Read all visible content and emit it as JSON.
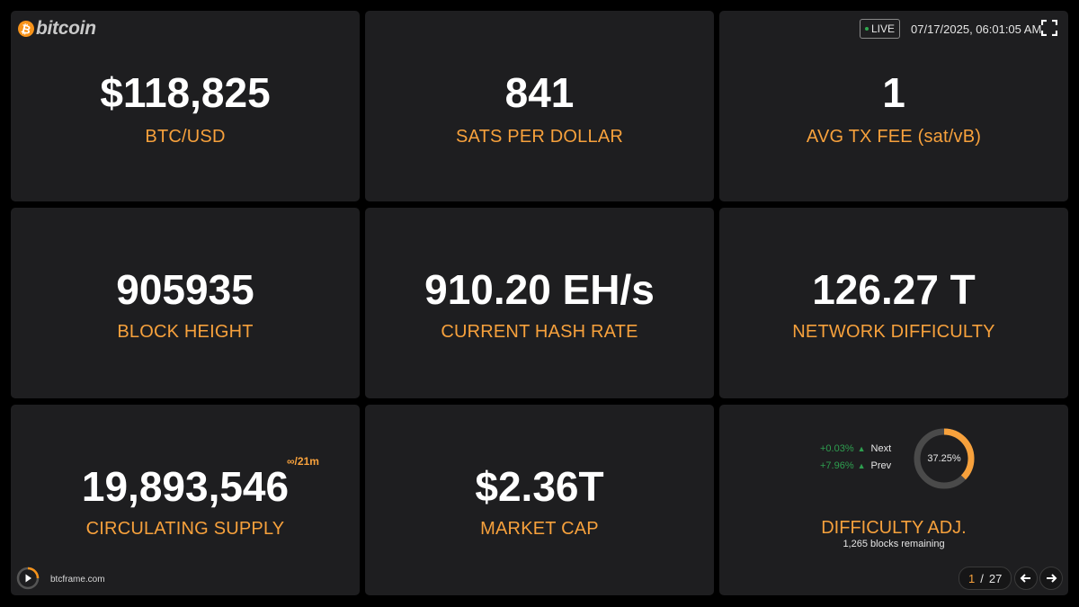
{
  "header": {
    "logo_text": "bitcoin",
    "logo_symbol": "₿",
    "live_label": "LIVE",
    "datetime": "07/17/2025, 06:01:05 AM"
  },
  "cards": {
    "btc_usd": {
      "value": "$118,825",
      "label": "BTC/USD"
    },
    "sats_per_dollar": {
      "value": "841",
      "label": "SATS PER DOLLAR"
    },
    "avg_tx_fee": {
      "value": "1",
      "label": "AVG TX FEE (sat/vB)"
    },
    "block_height": {
      "value": "905935",
      "label": "BLOCK HEIGHT"
    },
    "hash_rate": {
      "value": "910.20 EH/s",
      "label": "CURRENT HASH RATE"
    },
    "network_difficulty": {
      "value": "126.27 T",
      "label": "NETWORK DIFFICULTY"
    },
    "circulating_supply": {
      "value": "19,893,546",
      "label": "CIRCULATING SUPPLY",
      "max_note": "∞/21m"
    },
    "market_cap": {
      "value": "$2.36T",
      "label": "MARKET CAP"
    },
    "difficulty_adj": {
      "label": "DIFFICULTY ADJ.",
      "blocks_remaining": "1,265 blocks remaining",
      "progress_text": "37.25%",
      "progress_fraction": 0.3725,
      "next": {
        "pct": "+0.03%",
        "arrow": "▲",
        "name": "Next"
      },
      "prev": {
        "pct": "+7.96%",
        "arrow": "▲",
        "name": "Prev"
      }
    }
  },
  "footer": {
    "site": "btcframe.com",
    "page_current": "1",
    "page_sep": "/",
    "page_total": "27"
  },
  "colors": {
    "accent": "#f7a13c",
    "card_bg": "#1e1e20",
    "positive": "#2e9e4f"
  }
}
